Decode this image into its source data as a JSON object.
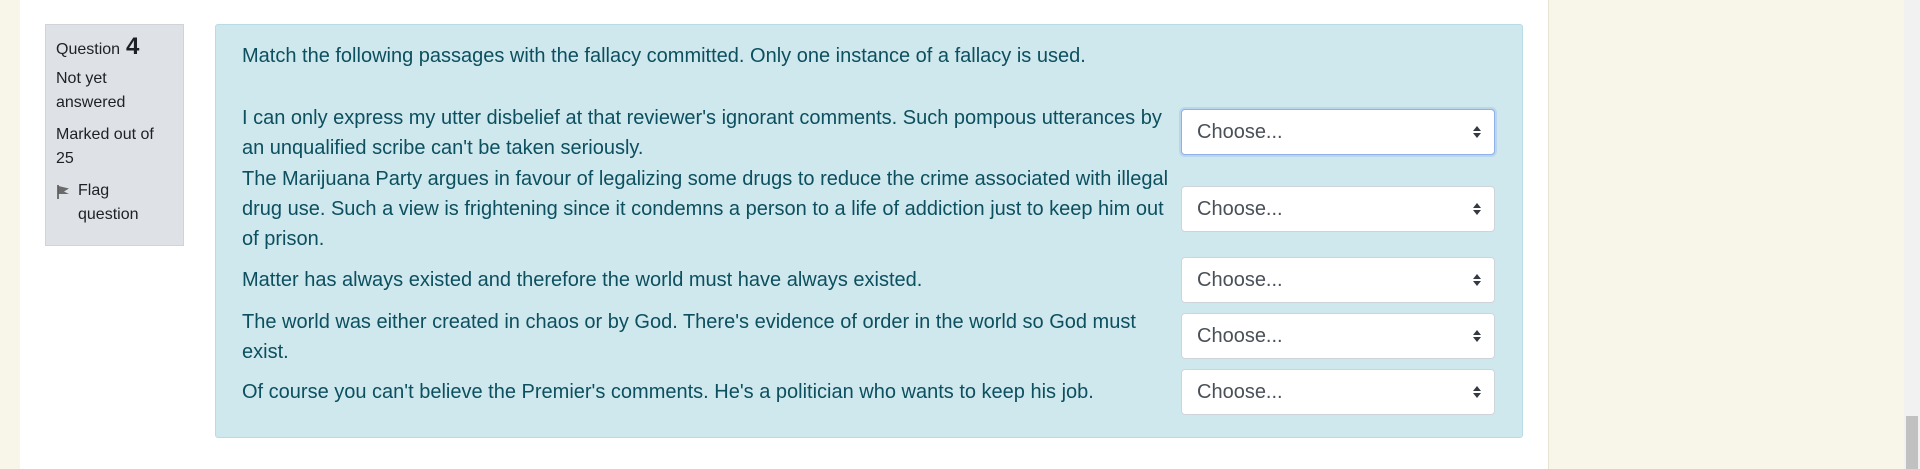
{
  "sidebar": {
    "question_word": "Question",
    "question_number": "4",
    "status": "Not yet answered",
    "marks": "Marked out of 25",
    "flag_label": "Flag question"
  },
  "question": {
    "prompt": "Match the following passages with the fallacy committed. Only one instance of a fallacy is used.",
    "items": [
      {
        "stem": "I can only express my utter disbelief at that reviewer's ignorant comments. Such pompous utterances by an unqualified scribe can't be taken seriously.",
        "selected": "Choose..."
      },
      {
        "stem": "The Marijuana Party argues in favour of legalizing some drugs to reduce the crime associated with illegal drug use. Such a view is frightening since it condemns a person to a life of addiction just to keep him out of prison.",
        "selected": "Choose..."
      },
      {
        "stem": "Matter has always existed and therefore the world must have always existed.",
        "selected": "Choose..."
      },
      {
        "stem": "The world was either created in chaos or by God. There's evidence of order in the world so God must exist.",
        "selected": "Choose..."
      },
      {
        "stem": "Of course you can't believe the Premier's comments. He's a politician who wants to keep his job.",
        "selected": "Choose..."
      }
    ]
  },
  "icons": {
    "flag": "flag-icon",
    "select_caret": "sort-caret-icon"
  },
  "colors": {
    "page_bg": "#f8f6e9",
    "question_bg": "#cfe8ee",
    "question_text": "#0c4f5e",
    "info_bg": "#dee2e6"
  }
}
